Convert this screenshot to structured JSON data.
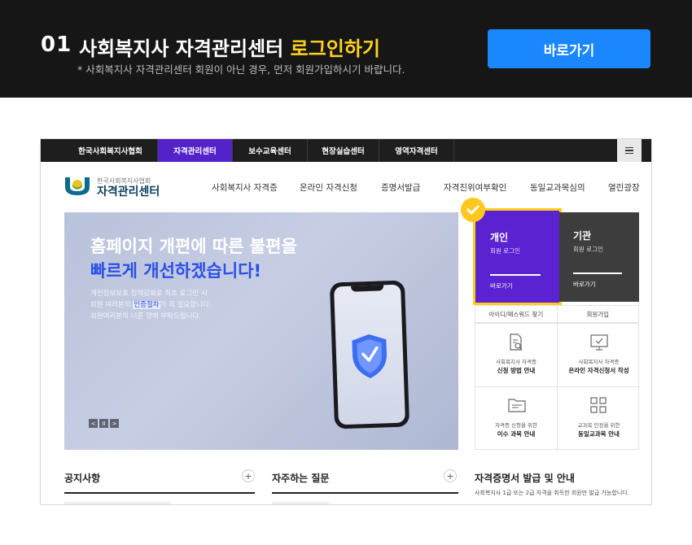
{
  "header": {
    "step_number": "01",
    "title_main": "사회복지사 자격관리센터",
    "title_highlight": "로그인하기",
    "note": "* 사회복지사 자격관리센터 회원이 아닌 경우, 먼저 회원가입하시기 바랍니다.",
    "go_button": "바로가기"
  },
  "site": {
    "gnb_tabs": [
      "한국사회복지사협회",
      "자격관리센터",
      "보수교육센터",
      "현장실습센터",
      "영역자격센터"
    ],
    "menu_icon": "hamburger-menu-icon",
    "logo_small": "한국사회복지사협회",
    "logo_big": "자격관리센터",
    "nav": [
      "사회복지사 자격증",
      "온라인 자격신청",
      "증명서발급",
      "자격진위여부확인",
      "동일교과목심의",
      "열린광장"
    ],
    "banner": {
      "line1": "홈페이지 개편에 따른 불편을",
      "line2": "빠르게 개선하겠습니다!",
      "desc1": "개인정보보호 정책강화로 최초 로그인 시",
      "desc2_pre": "회원 여러분의 ",
      "desc2_em": "인증절차",
      "desc2_post": "가 꼭 필요합니다.",
      "desc3": "회원여러분의 너른 양해 부탁드립니다.",
      "ctrl_prev": "<",
      "ctrl_pause": "II",
      "ctrl_next": ">"
    },
    "login_personal": {
      "title": "개인",
      "sub": "회원 로그인",
      "go": "바로가기"
    },
    "login_org": {
      "title": "기관",
      "sub": "회원 로그인",
      "go": "바로가기"
    },
    "links": [
      "아이디/패스워드 찾기",
      "회원가입"
    ],
    "quick": [
      {
        "small": "사회복지사 자격증",
        "big": "신청 방법 안내",
        "icon": "document-search-icon"
      },
      {
        "small": "사회복지사 자격증",
        "big": "온라인 자격신청서 작성",
        "icon": "monitor-check-icon"
      },
      {
        "small": "자격증 신청을 위한",
        "big": "이수 과목 안내",
        "icon": "folder-icon"
      },
      {
        "small": "교과목 인정을 위한",
        "big": "동일교과목 안내",
        "icon": "grid-squares-icon"
      }
    ],
    "sections": {
      "notice": "공지사항",
      "faq": "자주하는 질문",
      "cert": "자격증명서 발급 및 안내",
      "cert_note": "사회복지사 1급 또는 2급 자격을 취득한 회원만 발급 가능합니다.",
      "plus": "+"
    },
    "colors": {
      "active_tab": "#5322c9",
      "accent_blue": "#1a86ff",
      "highlight_yellow": "#ffd21f"
    }
  }
}
